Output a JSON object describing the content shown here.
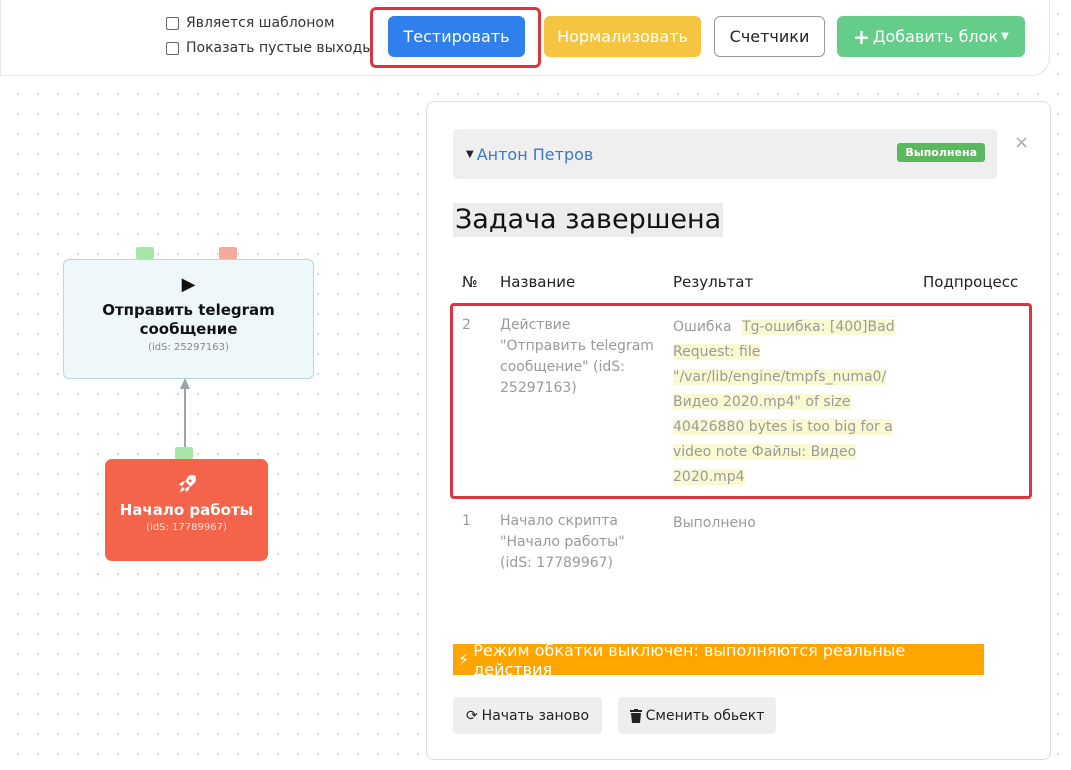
{
  "toolbar": {
    "is_template_label": "Является шаблоном",
    "show_empty_outputs_label": "Показать пустые выходы",
    "test_label": "Тестировать",
    "normalize_label": "Нормализовать",
    "counters_label": "Счетчики",
    "add_block_label": "Добавить блок",
    "colors": {
      "test": "#2f80ed",
      "normalize": "#f5c542",
      "add": "#66cc8a"
    }
  },
  "canvas": {
    "node_telegram": {
      "title": "Отправить telegram сообщение",
      "ids": "(idS: 25297163)",
      "icon": "play-icon"
    },
    "node_start": {
      "title": "Начало работы",
      "ids": "(idS: 17789967)",
      "icon": "rocket-icon",
      "color": "#f4644a"
    }
  },
  "panel": {
    "user_name": "Антон Петров",
    "status_badge": "Выполнена",
    "title": "Задача завершена",
    "columns": {
      "num": "№",
      "name": "Название",
      "result": "Результат",
      "subprocess": "Подпроцесс"
    },
    "rows": [
      {
        "num": "2",
        "name_lines": [
          "Действие",
          "\"Отправить telegram",
          "сообщение\" (idS:",
          "25297163)"
        ],
        "result_prefix": "Ошибка",
        "result_lines": [
          "Tg-ошибка: [400]Bad",
          "Request: file",
          "\"/var/lib/engine/tmpfs_numa0/",
          "Видео 2020.mp4\" of size",
          "40426880 bytes is too big for a",
          "video note Файлы: Видео",
          "2020.mp4"
        ]
      },
      {
        "num": "1",
        "name_lines": [
          "Начало скрипта",
          "\"Начало работы\"",
          "(idS: 17789967)"
        ],
        "result": "Выполнено"
      }
    ],
    "warning": "Режим обкатки выключен: выполняются реальные действия",
    "restart_label": "Начать заново",
    "change_object_label": "Сменить обьект"
  }
}
